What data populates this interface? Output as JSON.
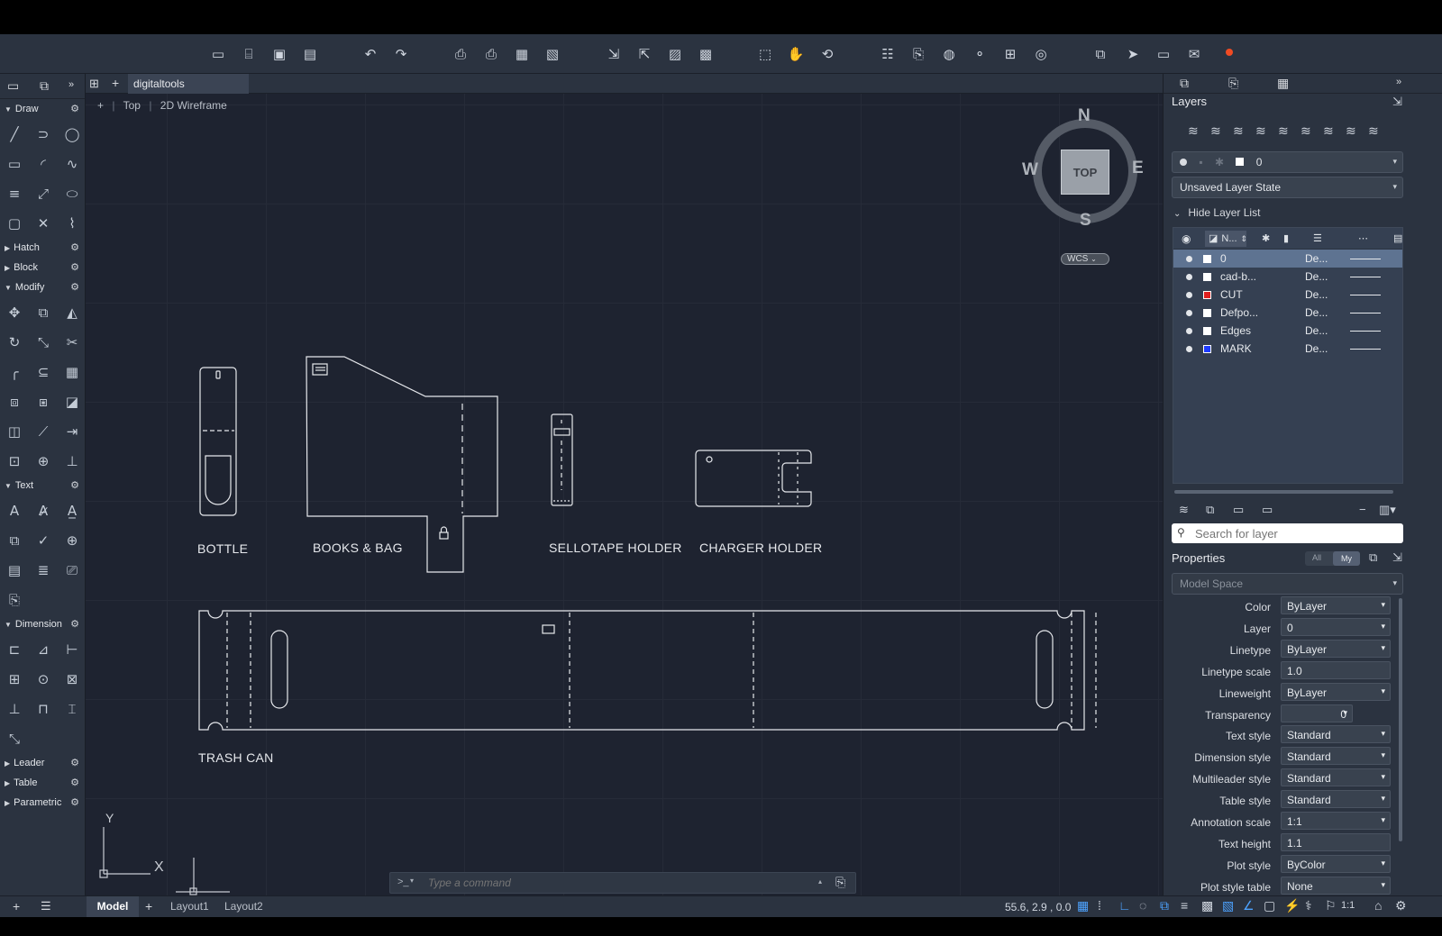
{
  "toolbar": {
    "icons": [
      "new-icon",
      "open-icon",
      "save-icon",
      "save-as-icon",
      "undo-icon",
      "redo-icon",
      "plot-icon",
      "batch-plot-icon",
      "page-setup-icon",
      "publish-icon",
      "import-icon",
      "export-icon",
      "open-sheet-icon",
      "share-icon",
      "zoom-window-icon",
      "pan-icon",
      "orbit-icon",
      "properties-icon",
      "matchprop-icon",
      "web-icon",
      "connect-icon",
      "measure-icon",
      "xref-icon",
      "compare-icon",
      "send-icon",
      "share-view-icon",
      "notifications-icon"
    ]
  },
  "tabs": {
    "active": "digitaltools",
    "add": "+"
  },
  "viewport": {
    "minus": "+",
    "view": "Top",
    "style": "2D Wireframe"
  },
  "leftpanel": {
    "sections": {
      "draw": "Draw",
      "hatch": "Hatch",
      "block": "Block",
      "modify": "Modify",
      "text": "Text",
      "dimension": "Dimension",
      "leader": "Leader",
      "table": "Table",
      "parametric": "Parametric"
    }
  },
  "viewcube": {
    "n": "N",
    "s": "S",
    "e": "E",
    "w": "W",
    "face": "TOP",
    "wcs": "WCS"
  },
  "drawing": {
    "labels": {
      "bottle": "BOTTLE",
      "books": "BOOKS & BAG",
      "sellotape": "SELLOTAPE HOLDER",
      "charger": "CHARGER HOLDER",
      "trash": "TRASH CAN"
    },
    "ucs": {
      "x": "X",
      "y": "Y"
    }
  },
  "layers": {
    "title": "Layers",
    "current_layer": "0",
    "layer_state": "Unsaved Layer State",
    "hide_list": "Hide Layer List",
    "col_name": "N...",
    "search_placeholder": "Search for layer",
    "rows": [
      {
        "name": "0",
        "desc": "De...",
        "color": "#ffffff",
        "selected": true
      },
      {
        "name": "cad-b...",
        "desc": "De...",
        "color": "#ffffff",
        "selected": false
      },
      {
        "name": "CUT",
        "desc": "De...",
        "color": "#e02020",
        "selected": false
      },
      {
        "name": "Defpo...",
        "desc": "De...",
        "color": "#ffffff",
        "selected": false
      },
      {
        "name": "Edges",
        "desc": "De...",
        "color": "#ffffff",
        "selected": false
      },
      {
        "name": "MARK",
        "desc": "De...",
        "color": "#1e3cff",
        "selected": false
      }
    ]
  },
  "properties": {
    "title": "Properties",
    "filter_all": "All",
    "filter_my": "My",
    "space": "Model Space",
    "rows": [
      {
        "label": "Color",
        "value": "ByLayer"
      },
      {
        "label": "Layer",
        "value": "0"
      },
      {
        "label": "Linetype",
        "value": "ByLayer"
      },
      {
        "label": "Linetype scale",
        "value": "1.0"
      },
      {
        "label": "Lineweight",
        "value": "ByLayer"
      },
      {
        "label": "Transparency",
        "value": "0"
      },
      {
        "label": "Text style",
        "value": "Standard"
      },
      {
        "label": "Dimension style",
        "value": "Standard"
      },
      {
        "label": "Multileader style",
        "value": "Standard"
      },
      {
        "label": "Table style",
        "value": "Standard"
      },
      {
        "label": "Annotation scale",
        "value": "1:1"
      },
      {
        "label": "Text height",
        "value": "1.1"
      },
      {
        "label": "Plot style",
        "value": "ByColor"
      },
      {
        "label": "Plot style table",
        "value": "None"
      }
    ]
  },
  "command": {
    "prompt": ">_",
    "placeholder": "Type a command"
  },
  "status": {
    "model": "Model",
    "layout1": "Layout1",
    "layout2": "Layout2",
    "coords": "55.6, 2.9 , 0.0",
    "scale": "1:1"
  },
  "colors": {
    "panel": "#2b3340",
    "canvas": "#1e2330",
    "accent": "#5e7391"
  }
}
